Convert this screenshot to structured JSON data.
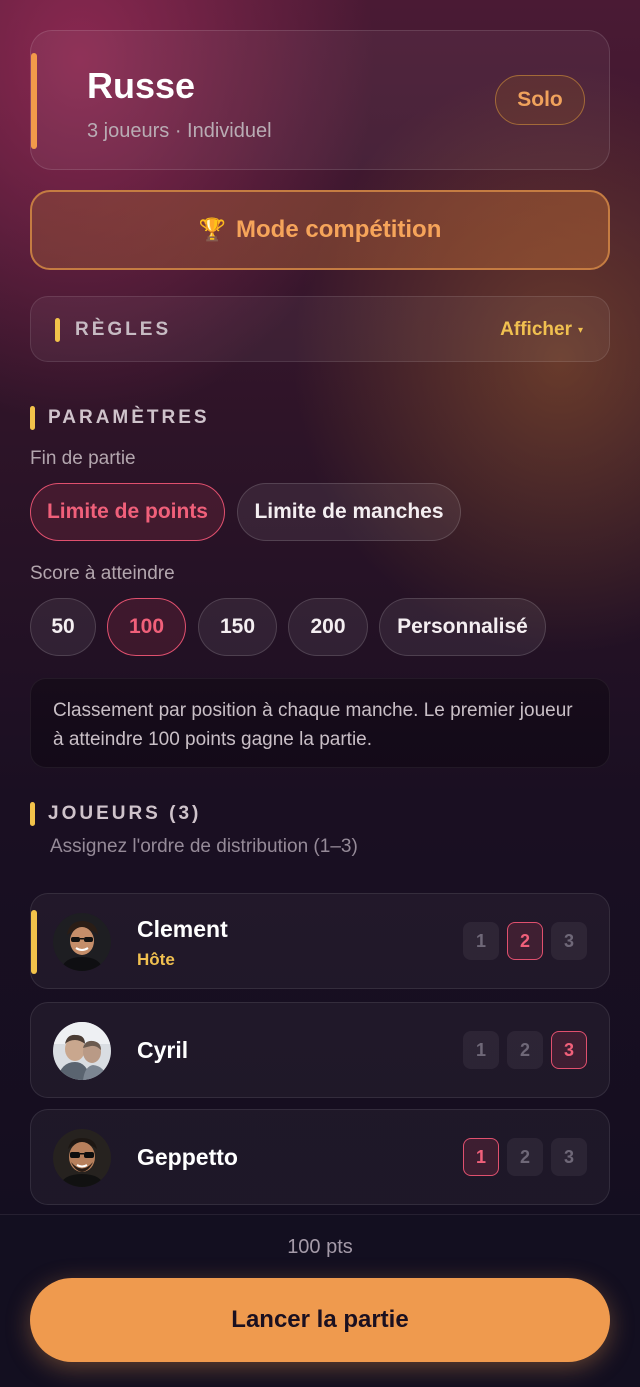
{
  "colors": {
    "accent_orange": "#ef9a4e",
    "accent_yellow": "#f2c24a",
    "accent_pink": "#e0506e",
    "background_top": "#4a1a34",
    "background_bottom": "#120e1f"
  },
  "header": {
    "title": "Russe",
    "subtitle": "3 joueurs · Individuel",
    "badge": "Solo"
  },
  "competition": {
    "icon": "trophy-icon",
    "icon_glyph": "🏆",
    "label": "Mode compétition"
  },
  "rules": {
    "label": "RÈGLES",
    "toggle": "Afficher",
    "toggle_icon": "▾"
  },
  "parameters": {
    "label": "PARAMÈTRES",
    "end_label": "Fin de partie",
    "end_options": [
      {
        "label": "Limite de points",
        "selected": true
      },
      {
        "label": "Limite de manches",
        "selected": false
      }
    ],
    "score_label": "Score à atteindre",
    "score_options": [
      {
        "label": "50",
        "selected": false
      },
      {
        "label": "100",
        "selected": true
      },
      {
        "label": "150",
        "selected": false
      },
      {
        "label": "200",
        "selected": false
      },
      {
        "label": "Personnalisé",
        "selected": false
      }
    ],
    "info": "Classement par position à chaque manche. Le premier joueur à atteindre 100 points gagne la partie."
  },
  "players": {
    "label": "JOUEURS (3)",
    "hint": "Assignez l'ordre de distribution (1–3)",
    "list": [
      {
        "name": "Clement",
        "tag": "Hôte",
        "order": 2,
        "order_options": [
          "1",
          "2",
          "3"
        ]
      },
      {
        "name": "Cyril",
        "tag": "",
        "order": 3,
        "order_options": [
          "1",
          "2",
          "3"
        ]
      },
      {
        "name": "Geppetto",
        "tag": "",
        "order": 1,
        "order_options": [
          "1",
          "2",
          "3"
        ]
      }
    ]
  },
  "footer": {
    "summary": "100 pts",
    "launch_label": "Lancer la partie"
  }
}
